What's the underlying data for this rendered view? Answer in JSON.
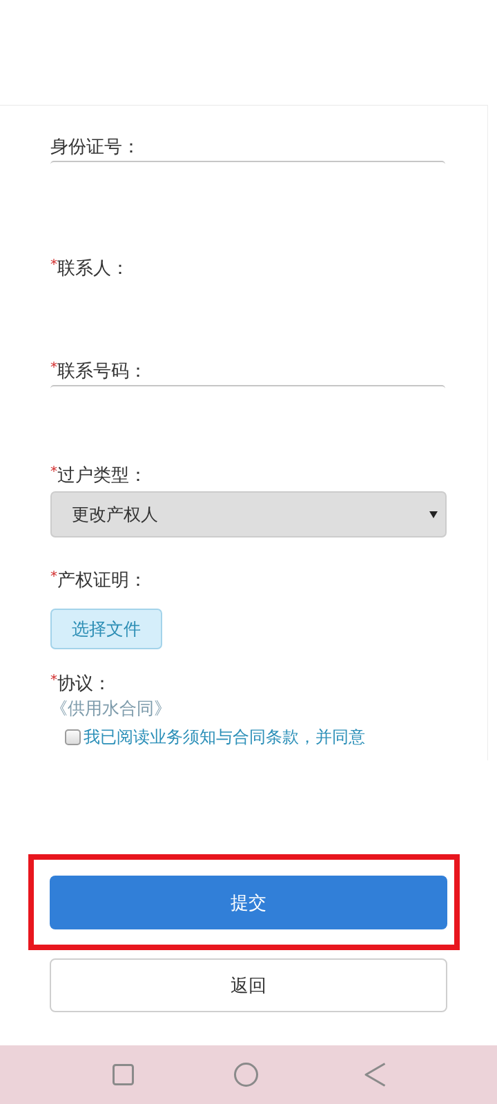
{
  "form": {
    "fields": [
      {
        "kind": "text",
        "label": "身份证号："
      },
      {
        "kind": "plain",
        "required_mark": "*",
        "label": "联系人："
      },
      {
        "kind": "text",
        "required_mark": "*",
        "label": "联系号码："
      },
      {
        "kind": "select",
        "required_mark": "*",
        "label": "过户类型：",
        "value": "更改产权人"
      },
      {
        "kind": "file",
        "required_mark": "*",
        "label": "产权证明：",
        "button": "选择文件"
      },
      {
        "kind": "agreement",
        "required_mark": "*",
        "label": "协议：",
        "link": "《供用水合同》",
        "checkbox": {
          "label": "我已阅读业务须知与合同条款，并同意",
          "checked": false
        }
      }
    ]
  },
  "buttons": [
    {
      "kind": "primary",
      "label": "提交",
      "highlighted": true
    },
    {
      "kind": "secondary",
      "label": "返回",
      "highlighted": false
    }
  ]
}
